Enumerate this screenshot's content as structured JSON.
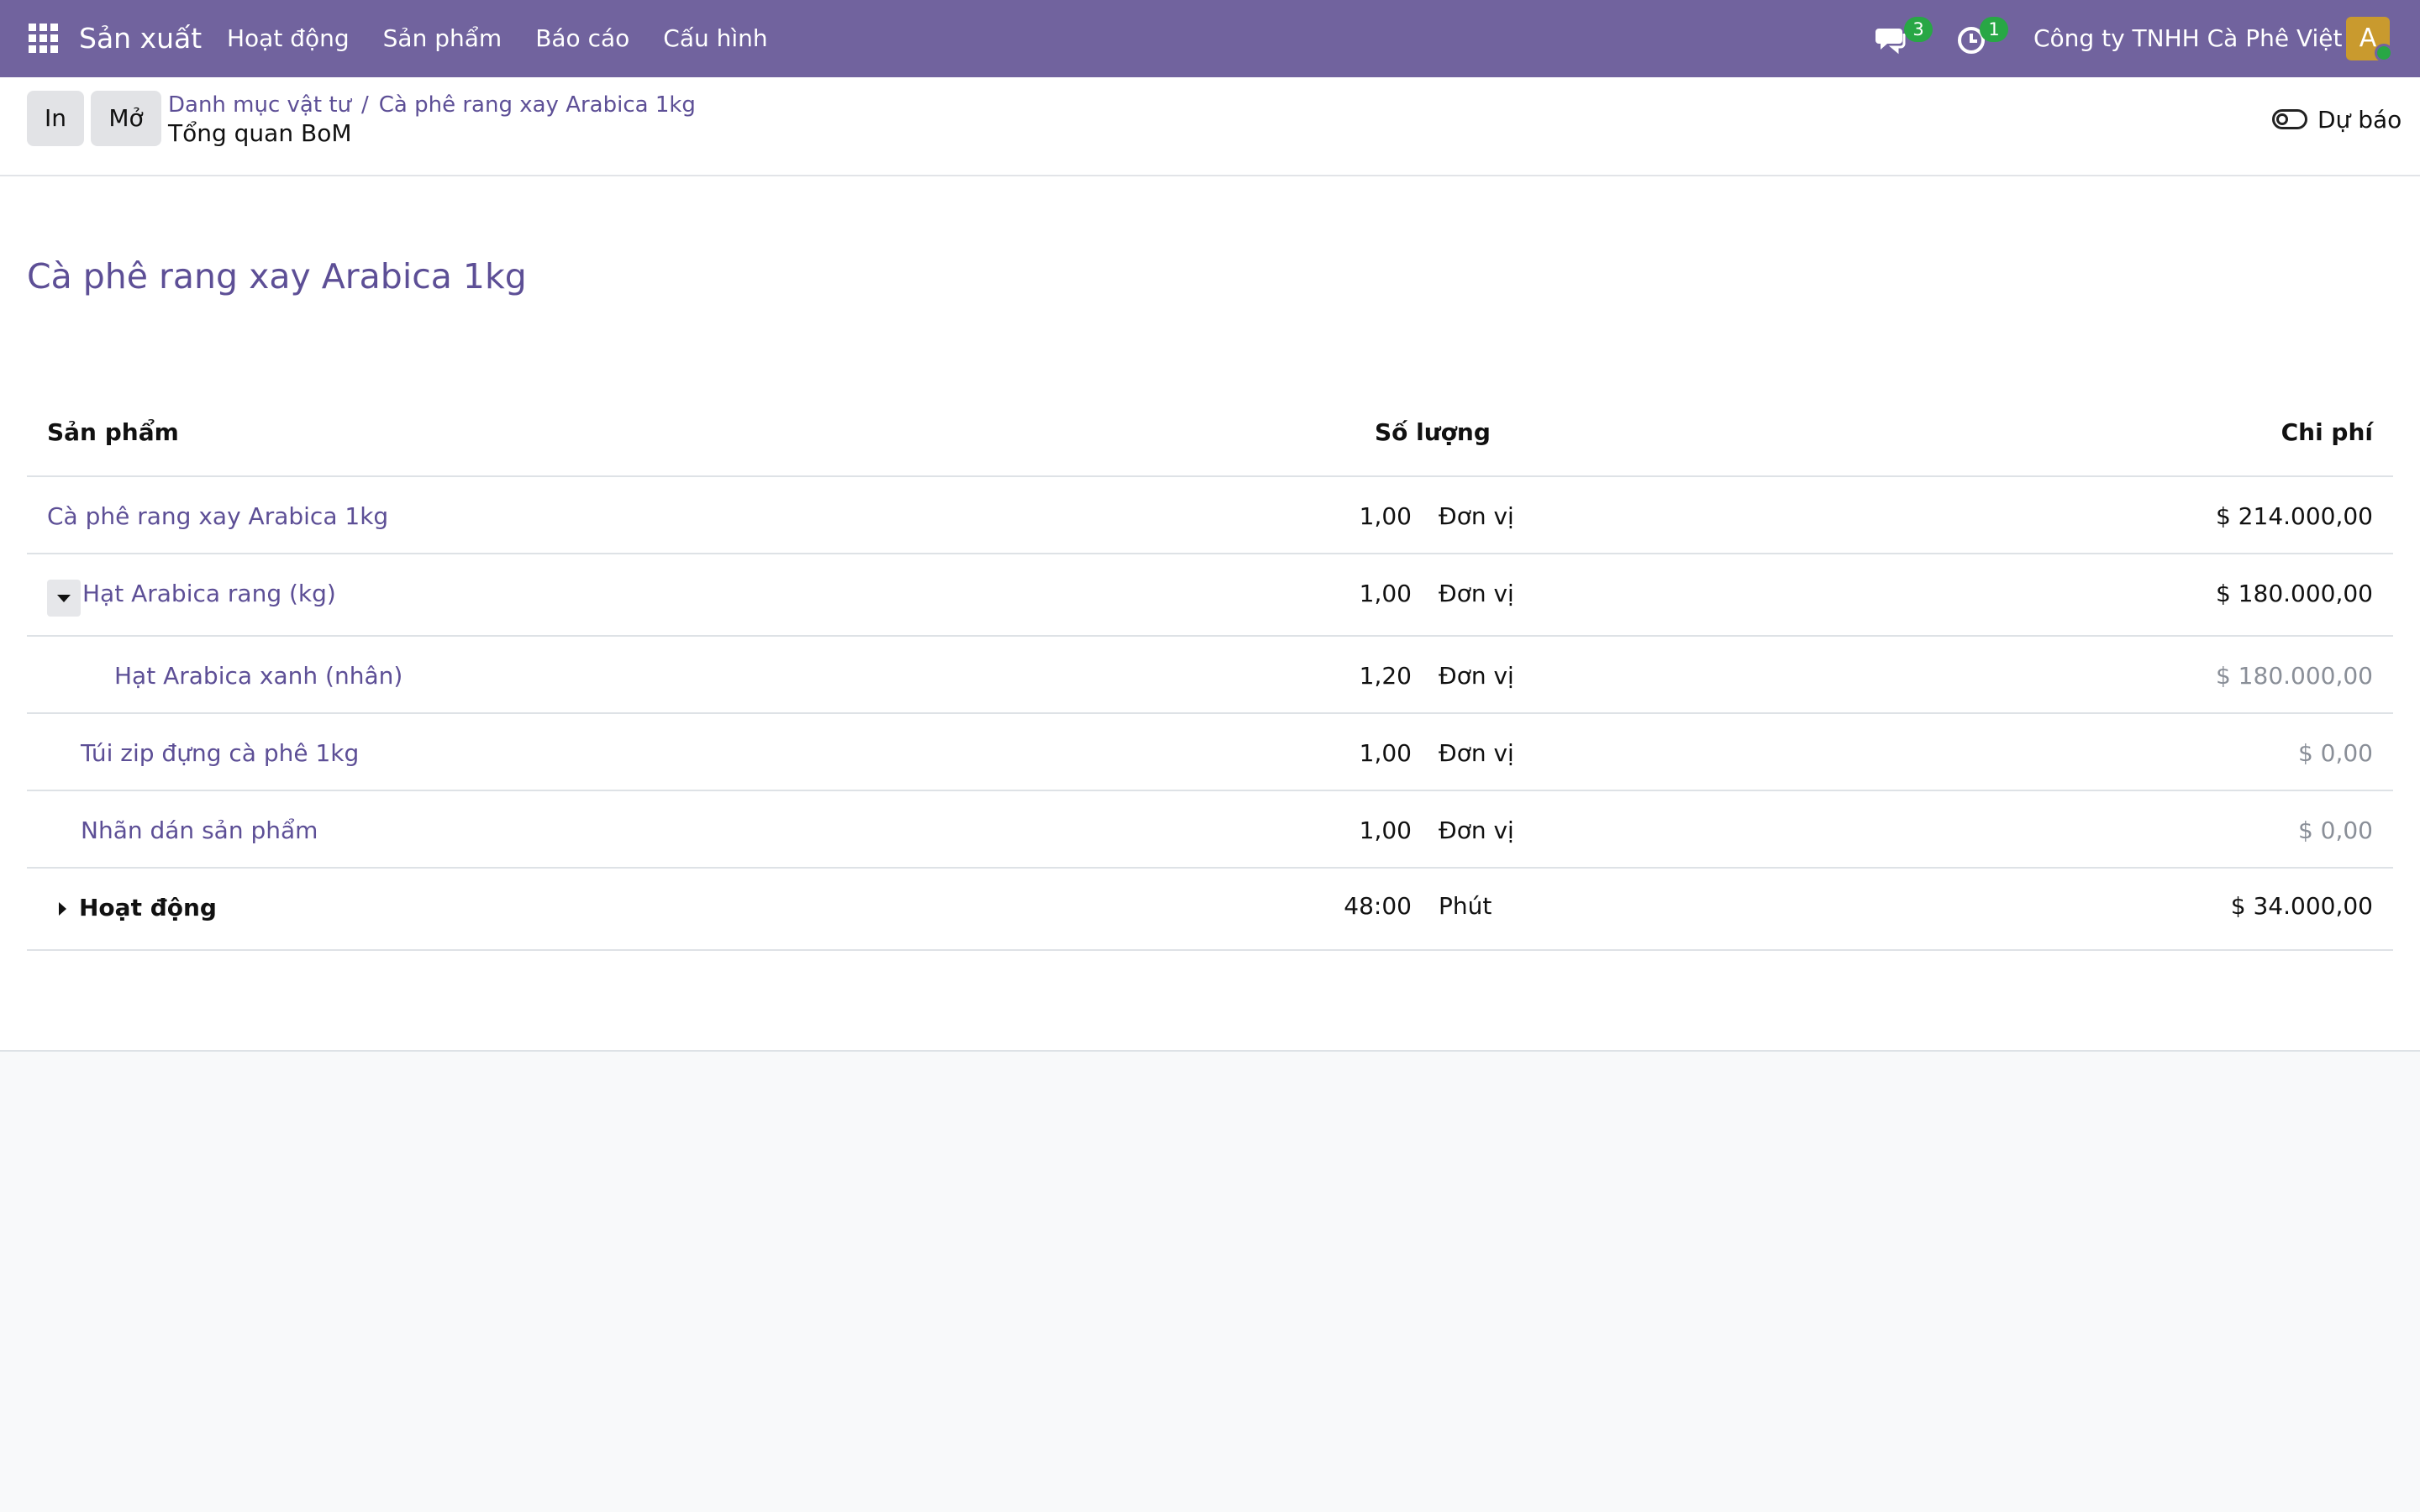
{
  "navbar": {
    "app_name": "Sản xuất",
    "menu": [
      "Hoạt động",
      "Sản phẩm",
      "Báo cáo",
      "Cấu hình"
    ],
    "messages_count": "3",
    "activities_count": "1",
    "company": "Công ty TNHH Cà Phê Việt",
    "avatar_letter": "A",
    "icons": [
      "apps-grid-icon",
      "chat-icon",
      "clock-icon"
    ]
  },
  "control_panel": {
    "print_label": "In",
    "open_label": "Mở",
    "breadcrumb": [
      "Danh mục vật tư",
      "Cà phê rang xay Arabica 1kg"
    ],
    "breadcrumb_sep": "/",
    "page_title": "Tổng quan BoM",
    "forecast_label": "Dự báo"
  },
  "bom": {
    "title": "Cà phê rang xay Arabica 1kg",
    "columns": {
      "product": "Sản phẩm",
      "quantity": "Số lượng",
      "cost": "Chi phí"
    },
    "rows": [
      {
        "product": "Cà phê rang xay Arabica 1kg",
        "qty": "1,00",
        "uom": "Đơn vị",
        "cost": "$ 214.000,00"
      },
      {
        "product": "Hạt Arabica rang (kg)",
        "qty": "1,00",
        "uom": "Đơn vị",
        "cost": "$ 180.000,00"
      },
      {
        "product": "Hạt Arabica xanh (nhân)",
        "qty": "1,20",
        "uom": "Đơn vị",
        "cost": "$ 180.000,00"
      },
      {
        "product": "Túi zip đựng cà phê 1kg",
        "qty": "1,00",
        "uom": "Đơn vị",
        "cost": "$ 0,00"
      },
      {
        "product": "Nhãn dán sản phẩm",
        "qty": "1,00",
        "uom": "Đơn vị",
        "cost": "$ 0,00"
      }
    ],
    "operations": {
      "label": "Hoạt động",
      "qty": "48:00",
      "uom": "Phút",
      "cost": "$ 34.000,00"
    }
  },
  "colors": {
    "navbar": "#71639e",
    "link": "#5d4f96",
    "badge": "#28a745",
    "avatar": "#c99a2e"
  }
}
